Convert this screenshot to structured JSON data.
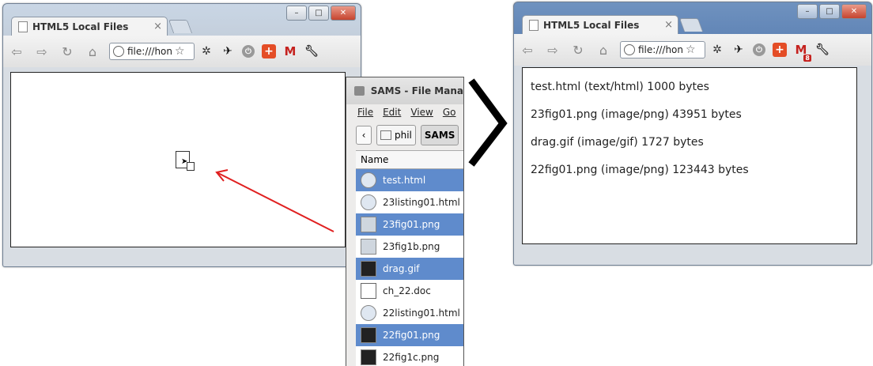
{
  "left_browser": {
    "tab_title": "HTML5 Local Files",
    "tab_close": "×",
    "address": "file:///hon",
    "window_buttons": [
      "–",
      "□",
      "✕"
    ]
  },
  "right_browser": {
    "tab_title": "HTML5 Local Files",
    "tab_close": "×",
    "address": "file:///hon",
    "window_buttons": [
      "–",
      "□",
      "✕"
    ],
    "gmail_badge": "8",
    "files": [
      "test.html (text/html) 1000 bytes",
      "23fig01.png (image/png) 43951 bytes",
      "drag.gif (image/gif) 1727 bytes",
      "22fig01.png (image/png) 123443 bytes"
    ]
  },
  "file_manager": {
    "title": "SAMS - File Mana",
    "menu": [
      "File",
      "Edit",
      "View",
      "Go"
    ],
    "back": "‹",
    "crumbs": [
      "phil",
      "SAMS"
    ],
    "column_header": "Name",
    "rows": [
      {
        "name": "test.html",
        "selected": true
      },
      {
        "name": "23listing01.html",
        "selected": false
      },
      {
        "name": "23fig01.png",
        "selected": true
      },
      {
        "name": "23fig1b.png",
        "selected": false
      },
      {
        "name": "drag.gif",
        "selected": true
      },
      {
        "name": "ch_22.doc",
        "selected": false
      },
      {
        "name": "22listing01.html",
        "selected": false
      },
      {
        "name": "22fig01.png",
        "selected": true
      },
      {
        "name": "22fig1c.png",
        "selected": false
      }
    ]
  },
  "colors": {
    "selection": "#5f8bcc",
    "arrow": "#e02020",
    "chevron": "#000000"
  }
}
